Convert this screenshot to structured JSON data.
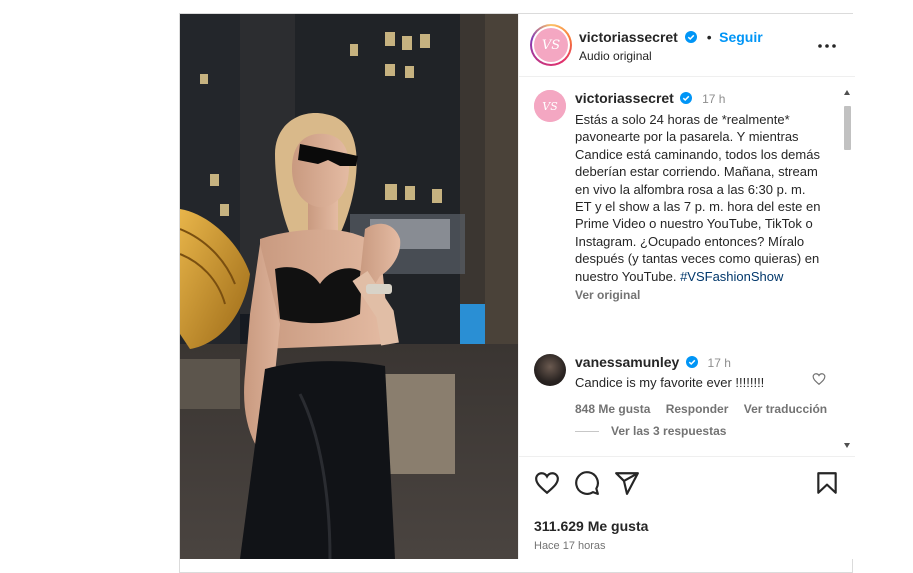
{
  "post": {
    "account": "victoriassecret",
    "follow_label": "Seguir",
    "separator": "•",
    "audio": "Audio original",
    "caption_time": "17 h",
    "caption": "Estás a solo 24 horas de *realmente* pavonearte por la pasarela. Y mientras Candice está caminando, todos los demás deberían estar corriendo. Mañana, stream en vivo la alfombra rosa a las 6:30 p. m. ET y el show a las 7 p. m. hora del este en Prime Video o nuestro YouTube, TikTok o Instagram. ¿Ocupado entonces? Míralo después (y tantas veces como quieras) en nuestro YouTube.",
    "hashtag": "#VSFashionShow",
    "see_translation": "Ver original",
    "likes": "311.629 Me gusta",
    "posted": "Hace 17 horas"
  },
  "comment": {
    "user": "vanessamunley",
    "time": "17 h",
    "text": "Candice is my favorite ever !!!!!!!!",
    "likes": "848 Me gusta",
    "reply": "Responder",
    "translate": "Ver traducción",
    "view_replies": "Ver las 3 respuestas"
  },
  "colors": {
    "link": "#0095f6",
    "verified": "#0095f6",
    "vs_pink": "#f4a7c2"
  },
  "icons": [
    "verified-icon",
    "more-options-icon",
    "heart-icon",
    "comment-icon",
    "share-icon",
    "bookmark-icon"
  ]
}
